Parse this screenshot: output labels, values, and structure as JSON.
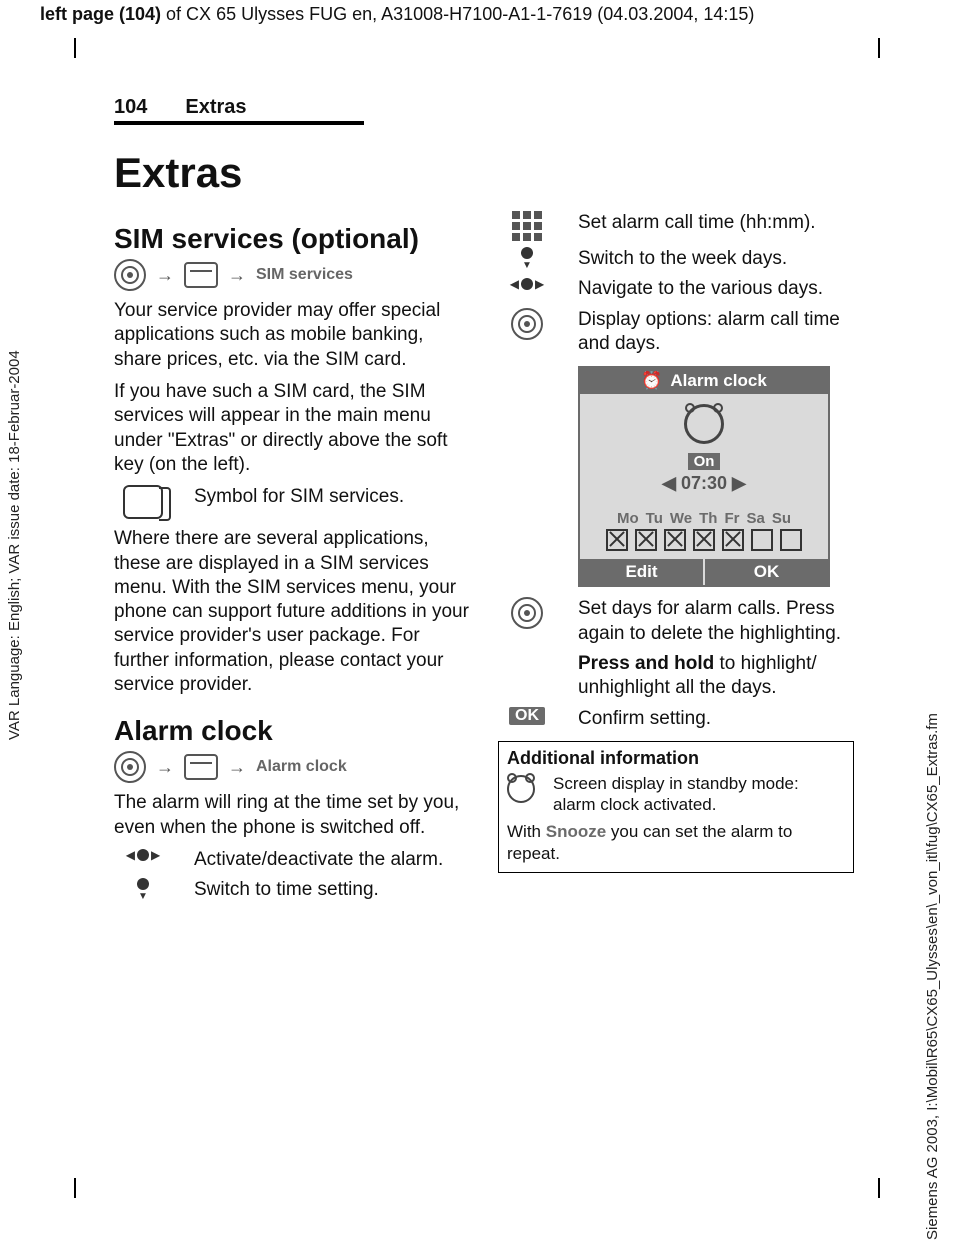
{
  "top_banner": {
    "prefix": "left page (104)",
    "rest": " of CX 65 Ulysses FUG en, A31008-H7100-A1-1-7619 (04.03.2004, 14:15)"
  },
  "margin_left": "VAR Language: English; VAR issue date: 18-Februar-2004",
  "margin_right": "Siemens AG 2003, I:\\Mobil\\R65\\CX65_Ulysses\\en\\_von_itl\\fug\\CX65_Extras.fm",
  "running_head": {
    "page_number": "104",
    "section": "Extras"
  },
  "title": "Extras",
  "left_col": {
    "h_sim": "SIM services (optional)",
    "bc_sim": "SIM services",
    "p1": "Your service provider may offer special applications such as mobile banking, share prices, etc. via the SIM card.",
    "p2": "If you have such a SIM card, the SIM services will appear in the main menu under \"Extras\" or directly above the soft key (on the left).",
    "sim_symbol": "Symbol for SIM services.",
    "p3": "Where there are several applications, these are displayed in a SIM services menu. With the SIM services menu, your phone can support future additions in your service provider's user package. For further information, please contact your service provider.",
    "h_alarm": "Alarm clock",
    "bc_alarm": "Alarm clock",
    "p4": "The alarm will ring at the time set by you, even when the phone is switched off.",
    "r_activate": "Activate/deactivate the alarm.",
    "r_switch_time": "Switch to time setting."
  },
  "right_col": {
    "r_set_time": "Set alarm call time (hh:mm).",
    "r_switch_days": "Switch to the week days.",
    "r_navigate": "Navigate to the various days.",
    "r_display_opts": "Display options: alarm call time and days.",
    "r_set_days": "Set days for alarm calls. Press again to delete the highlighting.",
    "r_press_hold_bold": "Press and hold",
    "r_press_hold_rest": " to highlight/ unhighlight all the days.",
    "ok_label": "OK",
    "r_confirm": "Confirm setting."
  },
  "phone": {
    "title": "Alarm clock",
    "state": "On",
    "time": "07:30",
    "days": [
      "Mo",
      "Tu",
      "We",
      "Th",
      "Fr",
      "Sa",
      "Su"
    ],
    "checked": [
      true,
      true,
      true,
      true,
      true,
      false,
      false
    ],
    "soft_left": "Edit",
    "soft_right": "OK"
  },
  "info_box": {
    "header": "Additional information",
    "row1": "Screen display in standby mode: alarm clock activated.",
    "p_prefix": "With ",
    "snooze": "Snooze",
    "p_suffix": " you can set the alarm to repeat."
  }
}
